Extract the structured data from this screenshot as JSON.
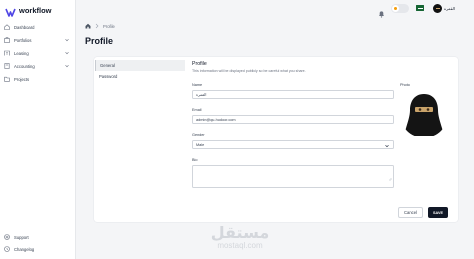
{
  "app": {
    "name": "workflow"
  },
  "sidebar": {
    "items": [
      {
        "label": "Dashboard",
        "icon": "dashboard-icon",
        "expandable": false
      },
      {
        "label": "Portfolios",
        "icon": "portfolio-icon",
        "expandable": true
      },
      {
        "label": "Leasing",
        "icon": "leasing-icon",
        "expandable": true
      },
      {
        "label": "Accounting",
        "icon": "accounting-icon",
        "expandable": true
      },
      {
        "label": "Projects",
        "icon": "projects-icon",
        "expandable": false
      }
    ],
    "footer": [
      {
        "label": "Support",
        "icon": "support-icon"
      },
      {
        "label": "Changelog",
        "icon": "changelog-icon"
      }
    ]
  },
  "topbar": {
    "user_name": "القمره"
  },
  "breadcrumb": {
    "current": "Profile"
  },
  "page": {
    "title": "Profile"
  },
  "tabs": [
    {
      "label": "General",
      "active": true
    },
    {
      "label": "Password",
      "active": false
    }
  ],
  "profile": {
    "section_title": "Profile",
    "section_subtitle": "This information will be displayed publicly so be careful what you share.",
    "name_label": "Name",
    "name_value": "القمرة",
    "email_label": "Email",
    "email_value": "admin@qu-hudoor.com",
    "gender_label": "Gender",
    "gender_value": "Male",
    "bio_label": "Bio",
    "photo_label": "Photo"
  },
  "actions": {
    "cancel_label": "Cancel",
    "save_label": "SAVE"
  },
  "watermark": {
    "arabic": "مستقل",
    "latin": "mostaql.com"
  },
  "colors": {
    "accent": "#111827",
    "sidebar_bg": "#ffffff",
    "page_bg": "#f4f5f7",
    "logo_blue": "#4f46e5"
  }
}
